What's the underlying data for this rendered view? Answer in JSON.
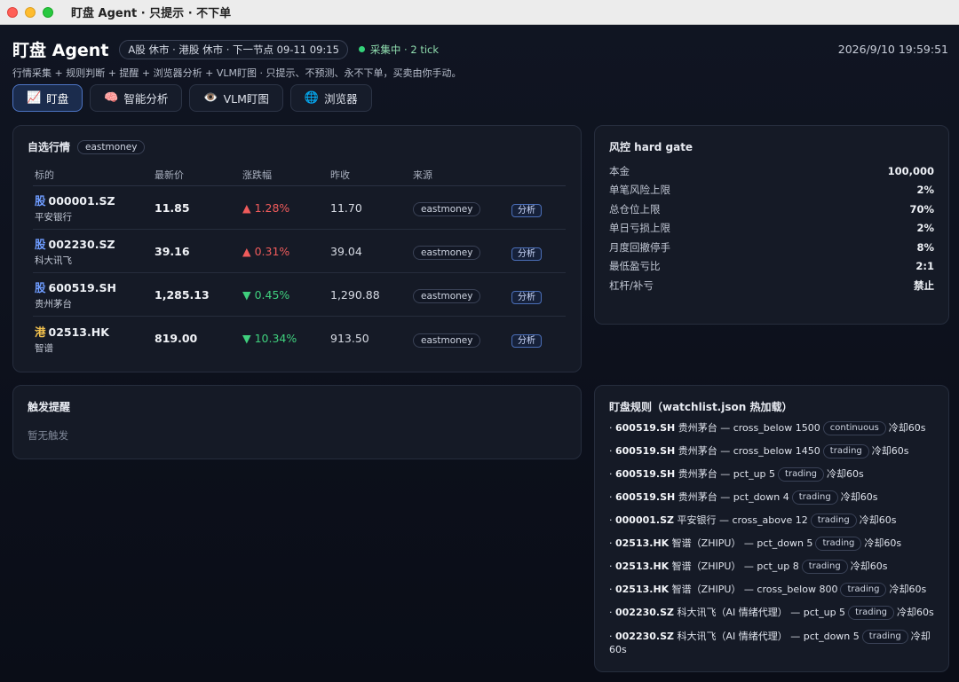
{
  "window": {
    "title": "盯盘 Agent · 只提示 · 不下单"
  },
  "header": {
    "brand": "盯盘 Agent",
    "market_status": "A股 休市 · 港股 休市 · 下一节点 09-11 09:15",
    "collect_status": "采集中 · 2 tick",
    "clock": "2026/9/10 19:59:51",
    "subtitle": "行情采集 + 规则判断 + 提醒 + 浏览器分析 + VLM盯图 · 只提示、不预测、永不下单，买卖由你手动。"
  },
  "tabs": [
    {
      "icon": "📈",
      "label": "盯盘",
      "active": true
    },
    {
      "icon": "🧠",
      "label": "智能分析",
      "active": false
    },
    {
      "icon": "👁️",
      "label": "VLM盯图",
      "active": false
    },
    {
      "icon": "🌐",
      "label": "浏览器",
      "active": false
    }
  ],
  "quotes": {
    "title": "自选行情",
    "source_chip": "eastmoney",
    "columns": [
      "标的",
      "最新价",
      "涨跌幅",
      "昨收",
      "来源",
      ""
    ],
    "rows": [
      {
        "market": "股",
        "symbol": "000001.SZ",
        "name": "平安银行",
        "price": "11.85",
        "change": "▲ 1.28%",
        "prev": "11.70",
        "source": "eastmoney",
        "action": "分析",
        "dir": "up"
      },
      {
        "market": "股",
        "symbol": "002230.SZ",
        "name": "科大讯飞",
        "price": "39.16",
        "change": "▲ 0.31%",
        "prev": "39.04",
        "source": "eastmoney",
        "action": "分析",
        "dir": "up"
      },
      {
        "market": "股",
        "symbol": "600519.SH",
        "name": "贵州茅台",
        "price": "1,285.13",
        "change": "▼ 0.45%",
        "prev": "1,290.88",
        "source": "eastmoney",
        "action": "分析",
        "dir": "down"
      },
      {
        "market": "港",
        "symbol": "02513.HK",
        "name": "智谱",
        "price": "819.00",
        "change": "▼ 10.34%",
        "prev": "913.50",
        "source": "eastmoney",
        "action": "分析",
        "dir": "down"
      }
    ]
  },
  "alerts": {
    "title": "触发提醒",
    "empty": "暂无触发"
  },
  "risk": {
    "title": "风控 hard gate",
    "items": [
      {
        "label": "本金",
        "value": "100,000"
      },
      {
        "label": "单笔风险上限",
        "value": "2%"
      },
      {
        "label": "总仓位上限",
        "value": "70%"
      },
      {
        "label": "单日亏损上限",
        "value": "2%"
      },
      {
        "label": "月度回撤停手",
        "value": "8%"
      },
      {
        "label": "最低盈亏比",
        "value": "2:1"
      },
      {
        "label": "杠杆/补亏",
        "value": "禁止"
      }
    ]
  },
  "rules": {
    "title": "盯盘规则（watchlist.json 热加载）",
    "items": [
      {
        "code": "600519.SH",
        "desc": " 贵州茅台 — cross_below 1500",
        "chip": "continuous",
        "cooldown": "冷却60s"
      },
      {
        "code": "600519.SH",
        "desc": " 贵州茅台 — cross_below 1450",
        "chip": "trading",
        "cooldown": "冷却60s"
      },
      {
        "code": "600519.SH",
        "desc": " 贵州茅台 — pct_up 5",
        "chip": "trading",
        "cooldown": "冷却60s"
      },
      {
        "code": "600519.SH",
        "desc": " 贵州茅台 — pct_down 4",
        "chip": "trading",
        "cooldown": "冷却60s"
      },
      {
        "code": "000001.SZ",
        "desc": " 平安银行 — cross_above 12",
        "chip": "trading",
        "cooldown": "冷却60s"
      },
      {
        "code": "02513.HK",
        "desc": " 智谱（ZHIPU） — pct_down 5",
        "chip": "trading",
        "cooldown": "冷却60s"
      },
      {
        "code": "02513.HK",
        "desc": " 智谱（ZHIPU） — pct_up 8",
        "chip": "trading",
        "cooldown": "冷却60s"
      },
      {
        "code": "02513.HK",
        "desc": " 智谱（ZHIPU） — cross_below 800",
        "chip": "trading",
        "cooldown": "冷却60s"
      },
      {
        "code": "002230.SZ",
        "desc": " 科大讯飞（AI 情绪代理） — pct_up 5",
        "chip": "trading",
        "cooldown": "冷却60s"
      },
      {
        "code": "002230.SZ",
        "desc": " 科大讯飞（AI 情绪代理） — pct_down 5",
        "chip": "trading",
        "cooldown": "冷却60s"
      }
    ]
  }
}
